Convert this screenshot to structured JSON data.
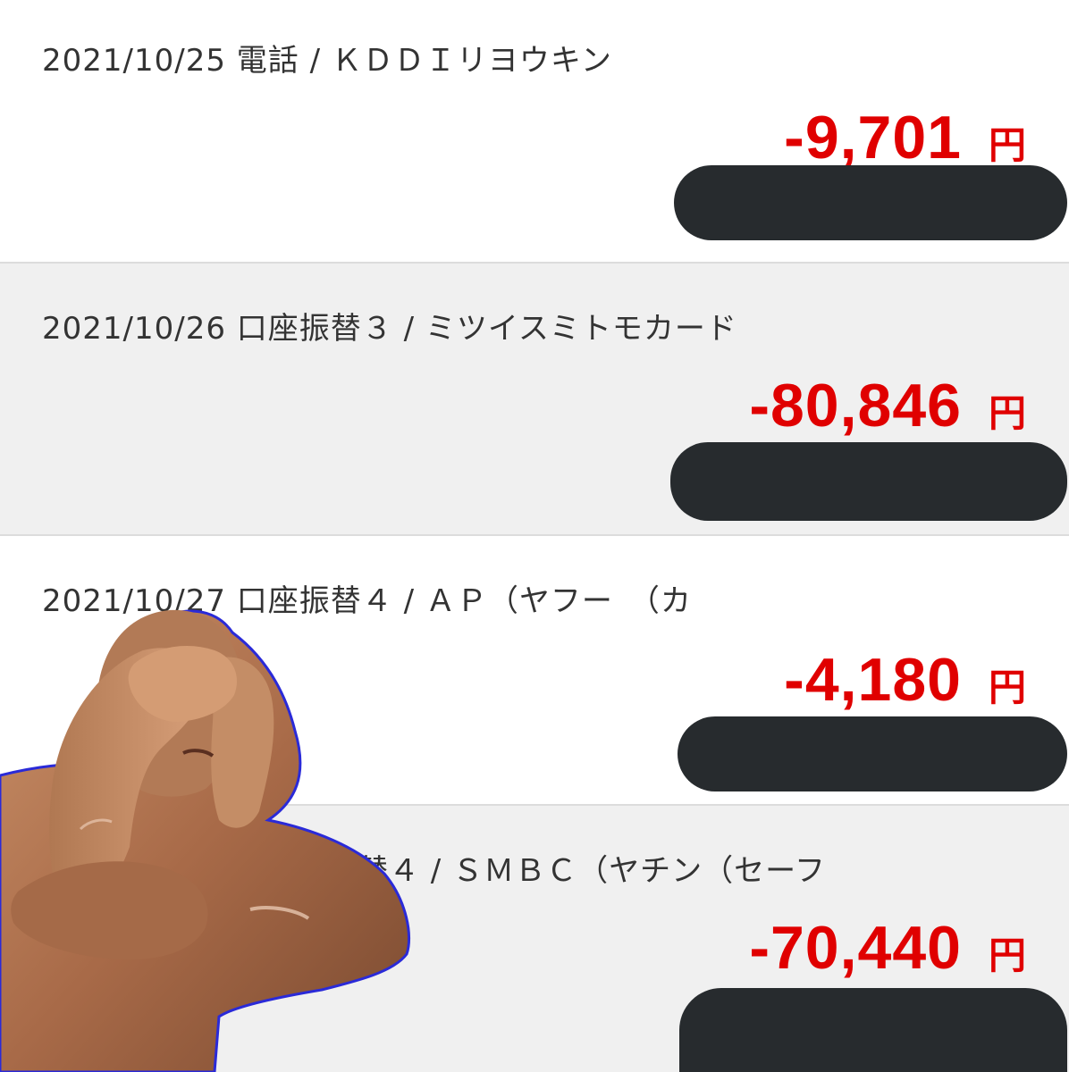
{
  "transactions": [
    {
      "description": "2021/10/25  電話 / ＫＤＤＩリヨウキン",
      "amount": "-9,701",
      "currency": "円",
      "balance_redacted": true
    },
    {
      "description": "2021/10/26  口座振替３ / ミツイスミトモカード",
      "amount": "-80,846",
      "currency": "円",
      "balance_redacted": true
    },
    {
      "description": "2021/10/27  口座振替４ / ＡＰ（ヤフー　（カ",
      "amount": "-4,180",
      "currency": "円",
      "balance_redacted": true
    },
    {
      "description": "替４ / ＳＭＢＣ（ヤチン（セーフ",
      "amount": "-70,440",
      "currency": "円",
      "balance_redacted": true
    }
  ],
  "colors": {
    "amount": "#e00000",
    "text": "#333333",
    "row_alt": "#f0f0f0",
    "redaction": "#272b2e",
    "overlay_outline": "#2a2ad8"
  },
  "overlay_image": "person-covering-face-sticker"
}
